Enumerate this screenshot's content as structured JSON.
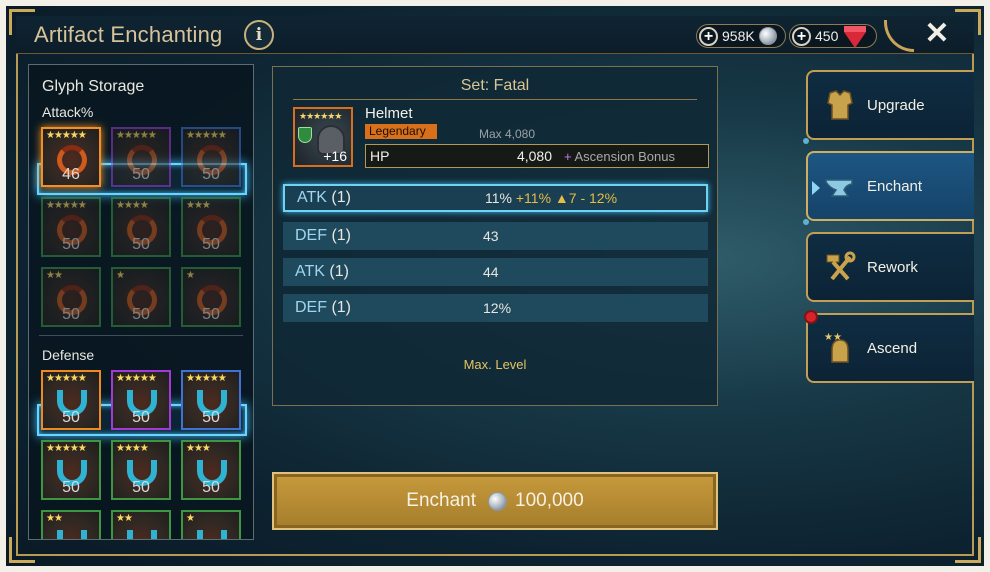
{
  "header": {
    "title": "Artifact Enchanting",
    "info_glyph": "i",
    "silver": "958K",
    "gems": "450",
    "plus_glyph": "+",
    "close_glyph": "✕"
  },
  "glyph_storage": {
    "title": "Glyph Storage",
    "attack_label": "Attack%",
    "defense_label": "Defense",
    "attack_glyphs": [
      {
        "stars": "★★★★★",
        "count": "46"
      },
      {
        "stars": "★★★★★",
        "count": "50"
      },
      {
        "stars": "★★★★★",
        "count": "50"
      },
      {
        "stars": "★★★★★",
        "count": "50"
      },
      {
        "stars": "★★★★",
        "count": "50"
      },
      {
        "stars": "★★★",
        "count": "50"
      },
      {
        "stars": "★★",
        "count": "50"
      },
      {
        "stars": "★",
        "count": "50"
      },
      {
        "stars": "★",
        "count": "50"
      }
    ],
    "defense_glyphs": [
      {
        "stars": "★★★★★",
        "count": "50"
      },
      {
        "stars": "★★★★★",
        "count": "50"
      },
      {
        "stars": "★★★★★",
        "count": "50"
      },
      {
        "stars": "★★★★★",
        "count": "50"
      },
      {
        "stars": "★★★★",
        "count": "50"
      },
      {
        "stars": "★★★",
        "count": "50"
      },
      {
        "stars": "★★",
        "count": "50"
      },
      {
        "stars": "★★",
        "count": "50"
      },
      {
        "stars": "★",
        "count": "50"
      }
    ]
  },
  "artifact": {
    "set_title": "Set: Fatal",
    "name": "Helmet",
    "rarity": "Legendary",
    "level": "+16",
    "stars": "★★★★★★",
    "max_label": "Max 4,080",
    "main_stat": {
      "name": "HP",
      "value": "4,080",
      "ascension_plus": "+",
      "ascension_text": "Ascension Bonus"
    },
    "substats": [
      {
        "name": "ATK",
        "rolls": "(1)",
        "value": "11%",
        "bonus": "+11% ▲7 - 12%"
      },
      {
        "name": "DEF",
        "rolls": "(1)",
        "value": "43",
        "bonus": ""
      },
      {
        "name": "ATK",
        "rolls": "(1)",
        "value": "44",
        "bonus": ""
      },
      {
        "name": "DEF",
        "rolls": "(1)",
        "value": "12%",
        "bonus": ""
      }
    ],
    "max_level_text": "Max. Level"
  },
  "enchant_button": {
    "label": "Enchant",
    "cost": "100,000"
  },
  "tabs": [
    {
      "label": "Upgrade",
      "icon": "armor-icon"
    },
    {
      "label": "Enchant",
      "icon": "anvil-icon"
    },
    {
      "label": "Rework",
      "icon": "hammer-wrench-icon"
    },
    {
      "label": "Ascend",
      "icon": "helmet-stars-icon"
    }
  ],
  "colors": {
    "gold": "#d9c594",
    "highlight_blue": "#69d4ff",
    "legendary": "#d86f1b",
    "active_tab": "#1d5683"
  }
}
